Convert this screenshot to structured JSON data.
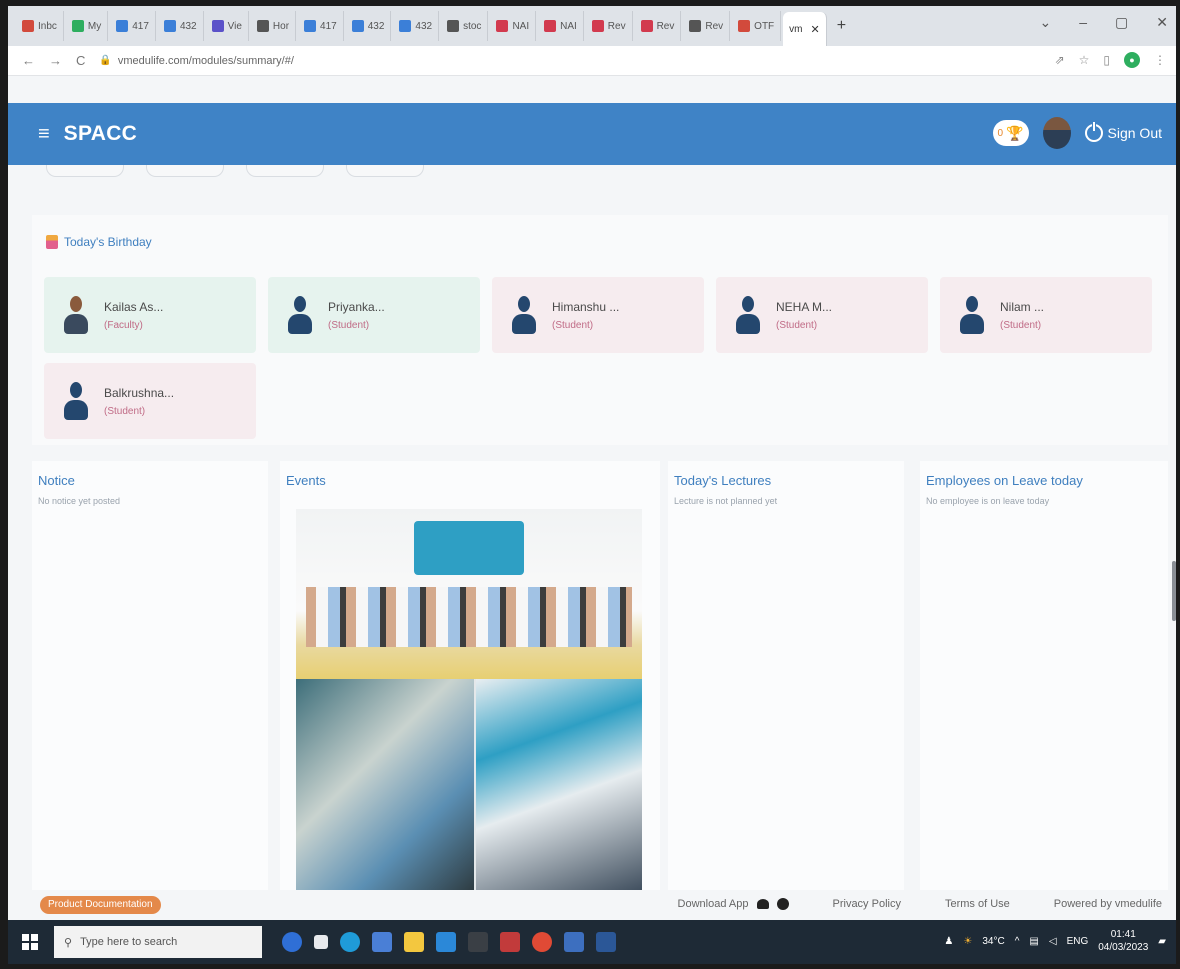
{
  "browser": {
    "tabs": [
      {
        "label": "Inbc",
        "color": "#d24a3c"
      },
      {
        "label": "My",
        "color": "#2eae5f"
      },
      {
        "label": "417",
        "color": "#3b7fd8"
      },
      {
        "label": "432",
        "color": "#3b7fd8"
      },
      {
        "label": "Vie",
        "color": "#5b52c9"
      },
      {
        "label": "Hor",
        "color": "#555555"
      },
      {
        "label": "417",
        "color": "#3b7fd8"
      },
      {
        "label": "432",
        "color": "#3b7fd8"
      },
      {
        "label": "432",
        "color": "#3b7fd8"
      },
      {
        "label": "stoc",
        "color": "#555555"
      },
      {
        "label": "NAI",
        "color": "#d23a4e"
      },
      {
        "label": "NAI",
        "color": "#d23a4e"
      },
      {
        "label": "Rev",
        "color": "#d23a4e"
      },
      {
        "label": "Rev",
        "color": "#d23a4e"
      },
      {
        "label": "Rev",
        "color": "#555555"
      },
      {
        "label": "OTF",
        "color": "#d24a3c"
      }
    ],
    "active_tab": "vm",
    "url": "vmedulife.com/modules/summary/#/"
  },
  "header": {
    "brand": "SPACC",
    "badge_count": "0",
    "sign_out": "Sign Out"
  },
  "birthday": {
    "title": "Today's Birthday",
    "people": [
      {
        "name": "Kailas As...",
        "role": "(Faculty)",
        "tone": "green",
        "photo": true
      },
      {
        "name": "Priyanka...",
        "role": "(Student)",
        "tone": "green",
        "photo": false
      },
      {
        "name": "Himanshu ...",
        "role": "(Student)",
        "tone": "pink",
        "photo": false
      },
      {
        "name": "NEHA M...",
        "role": "(Student)",
        "tone": "pink",
        "photo": false
      },
      {
        "name": "Nilam ...",
        "role": "(Student)",
        "tone": "pink",
        "photo": false
      },
      {
        "name": "Balkrushna...",
        "role": "(Student)",
        "tone": "pink",
        "photo": false
      }
    ]
  },
  "sections": {
    "notice": {
      "title": "Notice",
      "empty": "No notice yet posted"
    },
    "events": {
      "title": "Events"
    },
    "lectures": {
      "title": "Today's Lectures",
      "empty": "Lecture is not planned yet"
    },
    "leave": {
      "title": "Employees on Leave today",
      "empty": "No employee is on leave today"
    }
  },
  "footer": {
    "doc_button": "Product Documentation",
    "download": "Download App",
    "privacy": "Privacy Policy",
    "terms": "Terms of Use",
    "powered": "Powered by vmedulife"
  },
  "taskbar": {
    "search_placeholder": "Type here to search",
    "temperature": "34°C",
    "language": "ENG",
    "time": "01:41",
    "date": "04/03/2023"
  }
}
